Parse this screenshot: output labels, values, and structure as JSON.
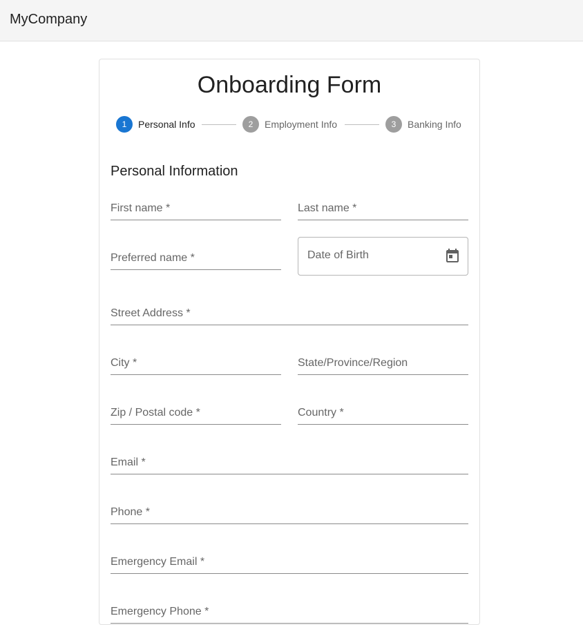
{
  "appbar": {
    "brand": "MyCompany"
  },
  "form": {
    "title": "Onboarding Form",
    "stepper": [
      {
        "number": "1",
        "label": "Personal Info",
        "active": true
      },
      {
        "number": "2",
        "label": "Employment Info",
        "active": false
      },
      {
        "number": "3",
        "label": "Banking Info",
        "active": false
      }
    ],
    "section_heading": "Personal Information",
    "fields": {
      "first_name": {
        "label": "First name *",
        "value": ""
      },
      "last_name": {
        "label": "Last name *",
        "value": ""
      },
      "preferred_name": {
        "label": "Preferred name *",
        "value": ""
      },
      "date_of_birth": {
        "label": "Date of Birth",
        "value": "",
        "icon": "calendar-icon"
      },
      "street_address": {
        "label": "Street Address *",
        "value": ""
      },
      "city": {
        "label": "City *",
        "value": ""
      },
      "state": {
        "label": "State/Province/Region",
        "value": ""
      },
      "zip": {
        "label": "Zip / Postal code *",
        "value": ""
      },
      "country": {
        "label": "Country *",
        "value": ""
      },
      "email": {
        "label": "Email *",
        "value": ""
      },
      "phone": {
        "label": "Phone *",
        "value": ""
      },
      "emergency_email": {
        "label": "Emergency Email *",
        "value": ""
      },
      "emergency_phone": {
        "label": "Emergency Phone *",
        "value": ""
      }
    }
  },
  "colors": {
    "accent": "#1976d2",
    "inactive_step": "#9e9e9e",
    "appbar_bg": "#f5f5f5",
    "label": "#666666"
  }
}
